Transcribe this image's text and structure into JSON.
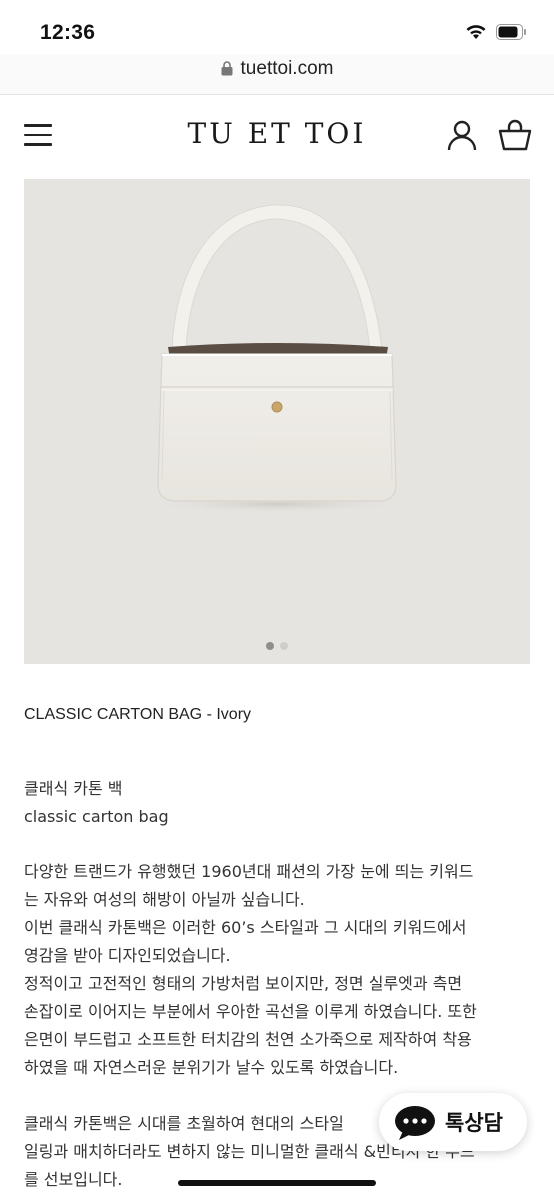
{
  "status_bar": {
    "time": "12:36"
  },
  "browser": {
    "url": "tuettoi.com"
  },
  "header": {
    "brand": "TU ET TOI"
  },
  "gallery": {
    "slide_count": 2,
    "active_slide": 1
  },
  "product": {
    "title": "CLASSIC CARTON BAG - Ivory",
    "name_kr": "클래식 카톤 백",
    "name_en": "classic carton bag",
    "description": [
      "다양한 트랜드가 유행했던 1960년대 패션의 가장 눈에 띄는 키워드",
      "는 자유와 여성의 해방이 아닐까 싶습니다.",
      "이번 클래식 카톤백은 이러한 60’s 스타일과 그 시대의 키워드에서",
      "영감을 받아 디자인되었습니다.",
      "정적이고 고전적인 형태의 가방처럼 보이지만, 정면 실루엣과 측면",
      "손잡이로 이어지는 부분에서 우아한 곡선을 이루게 하였습니다. 또한",
      "은면이 부드럽고 소프트한 터치감의 천연 소가죽으로 제작하여 착용",
      "하였을 때 자연스러운 분위기가 날수 있도록 하였습니다."
    ],
    "description2": [
      "클래식 카톤백은 시대를 초월하여 현대의 스타일",
      "일링과 매치하더라도 변하지 않는 미니멀한 클래식 &빈티지 한 무드",
      "를 선보입니다."
    ]
  },
  "chat": {
    "label": "톡상담"
  }
}
